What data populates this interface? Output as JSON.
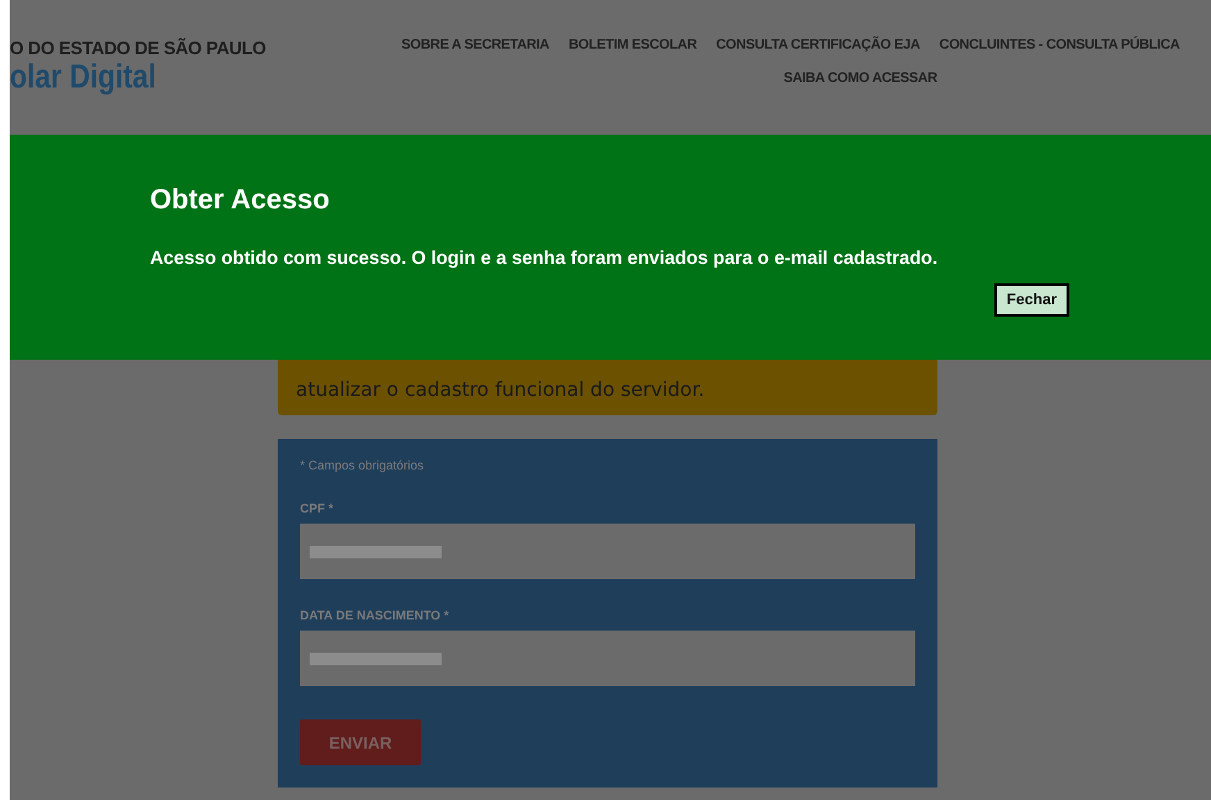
{
  "header": {
    "org": "O DO ESTADO DE SÃO PAULO",
    "brand": "olar Digital"
  },
  "nav": [
    {
      "label": "SOBRE A SECRETARIA"
    },
    {
      "label": "BOLETIM ESCOLAR"
    },
    {
      "label": "CONSULTA CERTIFICAÇÃO EJA"
    },
    {
      "label": "CONCLUINTES - CONSULTA PÚBLICA"
    },
    {
      "label": "SAIBA COMO ACESSAR"
    }
  ],
  "dialog": {
    "title": "Obter Acesso",
    "message": "Acesso obtido com sucesso. O login e a senha foram enviados para o e-mail cadastrado.",
    "button": "Fechar"
  },
  "notice": {
    "text": "atualizar o cadastro funcional do servidor."
  },
  "form": {
    "required_note": "* Campos obrigatórios",
    "fields": [
      {
        "label": "CPF *",
        "redacted": true
      },
      {
        "label": "DATA DE NASCIMENTO *",
        "redacted": true
      }
    ],
    "submit": "ENVIAR"
  }
}
